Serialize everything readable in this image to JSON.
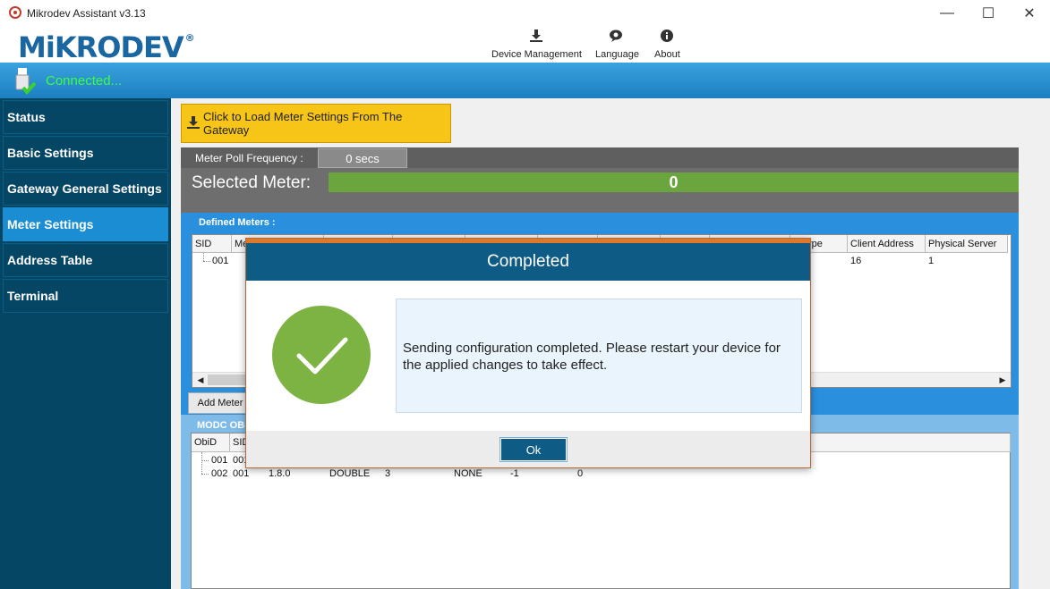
{
  "window": {
    "title": "Mikrodev Assistant v3.13",
    "controls": {
      "minimize": "—",
      "maximize": "☐",
      "close": "✕"
    }
  },
  "header": {
    "logo": {
      "part1": "MiKRO",
      "part2": "DEV",
      "reg": "®"
    },
    "menu": [
      {
        "label": "Device Management",
        "icon": "download-icon"
      },
      {
        "label": "Language",
        "icon": "language-icon"
      },
      {
        "label": "About",
        "icon": "info-icon"
      }
    ]
  },
  "status": {
    "text": "Connected...",
    "color": "#3dff3d"
  },
  "sidebar": {
    "items": [
      {
        "label": "Status"
      },
      {
        "label": "Basic Settings"
      },
      {
        "label": "Gateway General Settings"
      },
      {
        "label": "Meter Settings",
        "active": true
      },
      {
        "label": "Address Table"
      },
      {
        "label": "Terminal"
      }
    ]
  },
  "main": {
    "load_button": "Click to Load Meter Settings From The Gateway",
    "poll": {
      "label": "Meter Poll Frequency :",
      "value": "0 secs"
    },
    "selected_meter": {
      "label": "Selected Meter:",
      "value": "0"
    },
    "defined_meters": {
      "title": "Defined Meters :",
      "columns": [
        "SID",
        "Me",
        "",
        "",
        "",
        "",
        "",
        "",
        "",
        "n Type",
        "Client Address",
        "Physical Server"
      ],
      "rows": [
        {
          "sid": "001",
          "client_address": "16",
          "physical_server": "1"
        }
      ],
      "add_button": "Add Meter"
    },
    "obis": {
      "title": "MODC OBI",
      "columns": [
        "ObiD",
        "SID"
      ],
      "rows": [
        {
          "obid": "001",
          "sid": "001",
          "code": "",
          "type": "",
          "len": "",
          "scale": "",
          "v1": "",
          "v2": ""
        },
        {
          "obid": "002",
          "sid": "001",
          "code": "1.8.0",
          "type": "DOUBLE",
          "len": "3",
          "scale": "NONE",
          "v1": "-1",
          "v2": "0"
        }
      ]
    }
  },
  "dialog": {
    "title": "Completed",
    "message": "Sending configuration completed. Please restart your device for the applied changes to take effect.",
    "ok": "Ok",
    "accent": "#0e5c85",
    "success_color": "#7cb342"
  }
}
